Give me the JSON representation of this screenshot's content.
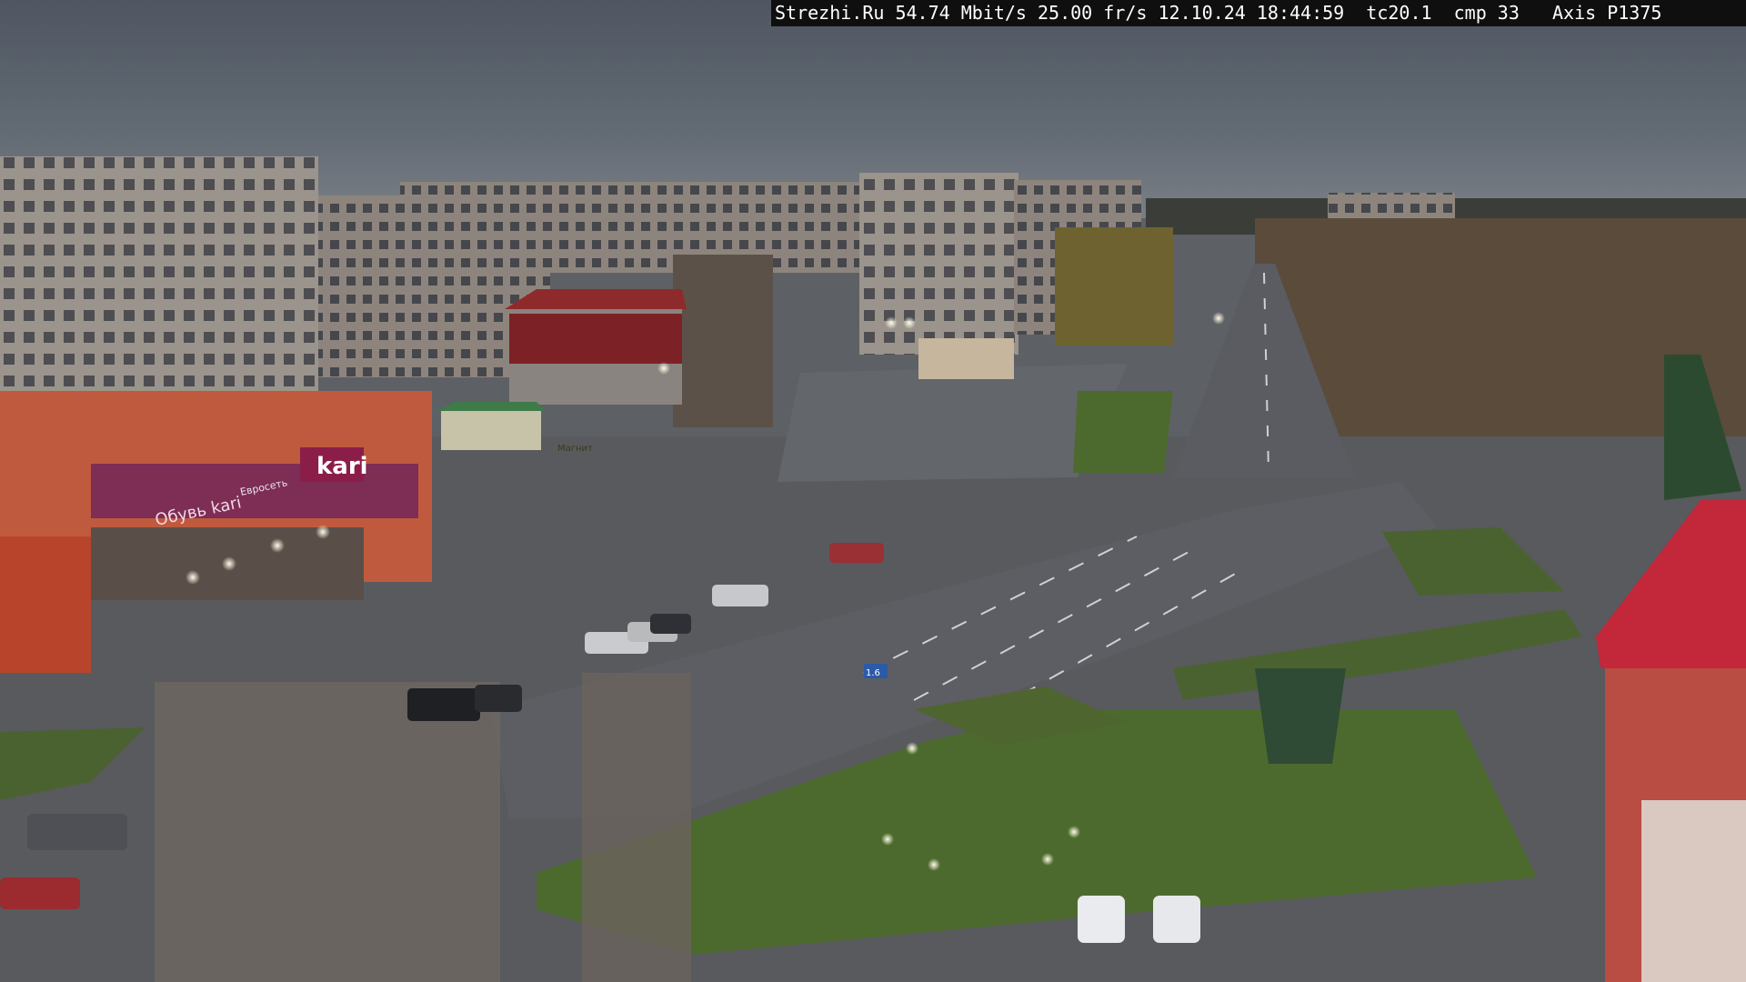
{
  "overlay": {
    "site": "Strezhi.Ru",
    "bitrate": "54.74 Mbit/s",
    "framerate": "25.00 fr/s",
    "date": "12.10.24",
    "time": "18:44:59",
    "tc": "tc20.1",
    "cmp": "cmp 33",
    "camera": "Axis P1375"
  },
  "signs": {
    "store_main": "kari",
    "store_side": "Обувь kari",
    "store_banner": "Евросеть",
    "shop_green": "Магнит",
    "road_sign": "1.6"
  },
  "colors": {
    "sky": "#5e6671",
    "asphalt": "#55575b",
    "grass": "#4c6630",
    "osd_bg": "#0f0f10",
    "osd_text": "#ffffff"
  }
}
